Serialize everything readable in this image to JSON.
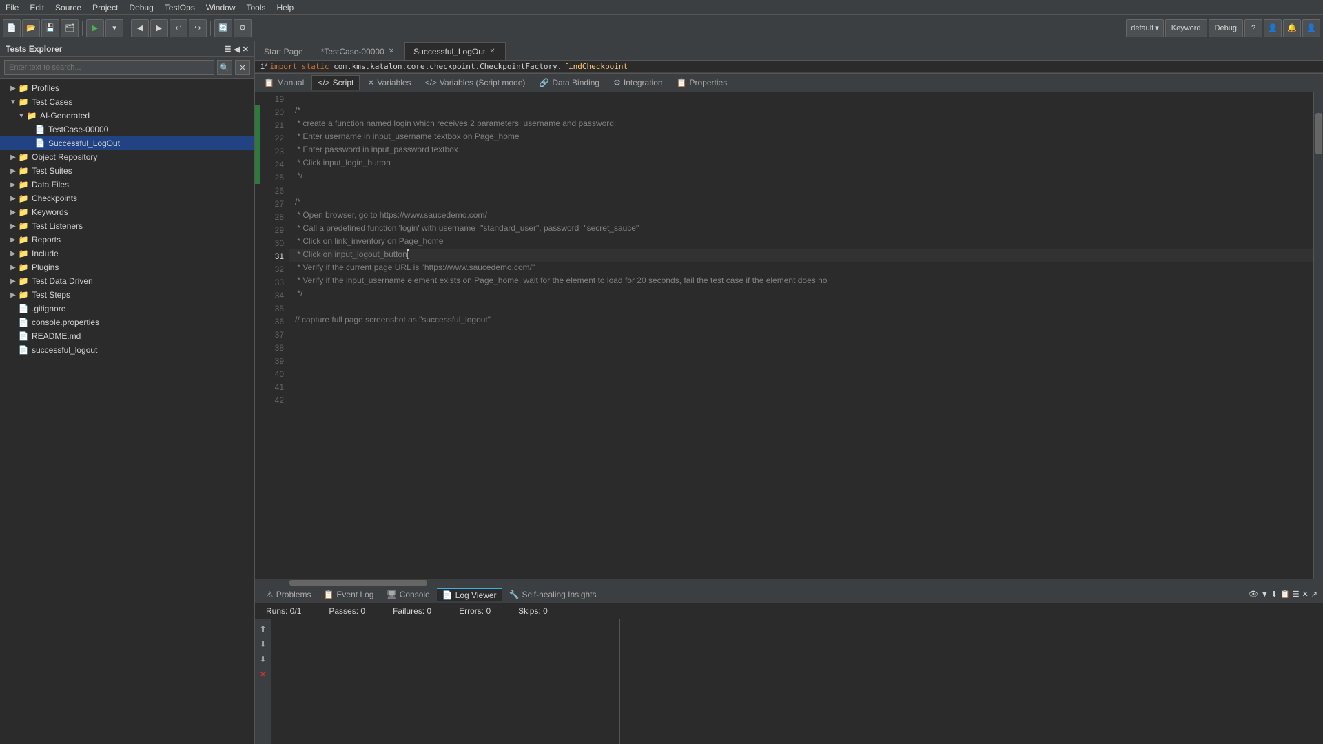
{
  "menubar": {
    "items": [
      "File",
      "Edit",
      "Source",
      "Project",
      "Debug",
      "TestOps",
      "Window",
      "Tools",
      "Help"
    ]
  },
  "toolbar": {
    "dropdown_profile": "default",
    "btn_keyword": "Keyword",
    "btn_debug": "Debug"
  },
  "sidebar": {
    "title": "Tests Explorer",
    "search_placeholder": "Enter text to search...",
    "tree": [
      {
        "id": "profiles",
        "label": "Profiles",
        "indent": 1,
        "arrow": "▶",
        "icon": "📁",
        "type": "folder"
      },
      {
        "id": "test-cases",
        "label": "Test Cases",
        "indent": 1,
        "arrow": "▼",
        "icon": "📁",
        "type": "folder",
        "expanded": true
      },
      {
        "id": "ai-generated",
        "label": "AI-Generated",
        "indent": 2,
        "arrow": "▼",
        "icon": "📁",
        "type": "folder"
      },
      {
        "id": "testcase-00000",
        "label": "TestCase-00000",
        "indent": 3,
        "arrow": "",
        "icon": "📄",
        "type": "file"
      },
      {
        "id": "successful-logout",
        "label": "Successful_LogOut",
        "indent": 3,
        "arrow": "",
        "icon": "📄",
        "type": "file",
        "selected": true
      },
      {
        "id": "object-repository",
        "label": "Object Repository",
        "indent": 1,
        "arrow": "▶",
        "icon": "📁",
        "type": "folder"
      },
      {
        "id": "test-suites",
        "label": "Test Suites",
        "indent": 1,
        "arrow": "▶",
        "icon": "📁",
        "type": "folder"
      },
      {
        "id": "data-files",
        "label": "Data Files",
        "indent": 1,
        "arrow": "▶",
        "icon": "📁",
        "type": "folder"
      },
      {
        "id": "checkpoints",
        "label": "Checkpoints",
        "indent": 1,
        "arrow": "▶",
        "icon": "📁",
        "type": "folder"
      },
      {
        "id": "keywords",
        "label": "Keywords",
        "indent": 1,
        "arrow": "▶",
        "icon": "📁",
        "type": "folder"
      },
      {
        "id": "test-listeners",
        "label": "Test Listeners",
        "indent": 1,
        "arrow": "▶",
        "icon": "📁",
        "type": "folder"
      },
      {
        "id": "reports",
        "label": "Reports",
        "indent": 1,
        "arrow": "▶",
        "icon": "📁",
        "type": "folder"
      },
      {
        "id": "include",
        "label": "Include",
        "indent": 1,
        "arrow": "▶",
        "icon": "📁",
        "type": "folder"
      },
      {
        "id": "plugins",
        "label": "Plugins",
        "indent": 1,
        "arrow": "▶",
        "icon": "📁",
        "type": "folder"
      },
      {
        "id": "test-data-driven",
        "label": "Test Data Driven",
        "indent": 1,
        "arrow": "▶",
        "icon": "📁",
        "type": "folder"
      },
      {
        "id": "test-steps",
        "label": "Test Steps",
        "indent": 1,
        "arrow": "▶",
        "icon": "📁",
        "type": "folder"
      },
      {
        "id": "gitignore",
        "label": ".gitignore",
        "indent": 1,
        "arrow": "",
        "icon": "📄",
        "type": "file"
      },
      {
        "id": "console-properties",
        "label": "console.properties",
        "indent": 1,
        "arrow": "",
        "icon": "📄",
        "type": "file"
      },
      {
        "id": "readme",
        "label": "README.md",
        "indent": 1,
        "arrow": "",
        "icon": "📄",
        "type": "file"
      },
      {
        "id": "successful-logout-file",
        "label": "successful_logout",
        "indent": 1,
        "arrow": "",
        "icon": "📄",
        "type": "file"
      }
    ]
  },
  "tabs": [
    {
      "id": "start-page",
      "label": "Start Page",
      "closable": false,
      "active": false
    },
    {
      "id": "testcase-00000-tab",
      "label": "*TestCase-00000",
      "closable": true,
      "active": false
    },
    {
      "id": "successful-logout-tab",
      "label": "Successful_LogOut",
      "closable": true,
      "active": true
    }
  ],
  "breadcrumb": "1* import static com.kms.katalon.core.checkpoint.CheckpointFactory.findCheckpoint",
  "code": {
    "lines": [
      {
        "num": "19",
        "content": "",
        "changed": false
      },
      {
        "num": "20",
        "content": "/* ",
        "changed": true,
        "parts": [
          {
            "t": "comment",
            "v": "/* "
          }
        ]
      },
      {
        "num": "21",
        "content": " * create a function named login which receives 2 parameters: username and password:",
        "changed": true
      },
      {
        "num": "22",
        "content": " * Enter username in input_username textbox on Page_home",
        "changed": true
      },
      {
        "num": "23",
        "content": " * Enter password in input_password textbox",
        "changed": true
      },
      {
        "num": "24",
        "content": " * Click input_login_button",
        "changed": true
      },
      {
        "num": "25",
        "content": " */ ",
        "changed": true
      },
      {
        "num": "26",
        "content": "",
        "changed": false
      },
      {
        "num": "27",
        "content": "/* ",
        "changed": false
      },
      {
        "num": "28",
        "content": " * Open browser, go to https://www.saucedemo.com/",
        "changed": false
      },
      {
        "num": "29",
        "content": " * Call a predefined function 'login' with username=\"standard_user\", password=\"secret_sauce\"",
        "changed": false
      },
      {
        "num": "30",
        "content": " * Click on link_inventory on Page_home",
        "changed": false
      },
      {
        "num": "31",
        "content": " * Click on input_logout_button",
        "changed": false
      },
      {
        "num": "32",
        "content": " * Verify if the current page URL is \"https://www.saucedemo.com/\"",
        "changed": false
      },
      {
        "num": "33",
        "content": " * Verify if the input_username element exists on Page_home, wait for the element to load for 20 seconds, fail the test case if the element does no",
        "changed": false
      },
      {
        "num": "34",
        "content": " */",
        "changed": false
      },
      {
        "num": "35",
        "content": "",
        "changed": false
      },
      {
        "num": "36",
        "content": "// capture full page screenshot as \"successful_logout\"",
        "changed": false
      },
      {
        "num": "37",
        "content": "",
        "changed": false
      },
      {
        "num": "38",
        "content": "",
        "changed": false
      },
      {
        "num": "39",
        "content": "",
        "changed": false
      },
      {
        "num": "40",
        "content": "",
        "changed": false
      },
      {
        "num": "41",
        "content": "",
        "changed": false
      },
      {
        "num": "42",
        "content": "",
        "changed": false
      }
    ]
  },
  "script_tabs": [
    {
      "id": "manual",
      "label": "Manual",
      "active": false
    },
    {
      "id": "script",
      "label": "Script",
      "active": true
    },
    {
      "id": "variables",
      "label": "Variables",
      "active": false
    },
    {
      "id": "variables-script",
      "label": "Variables (Script mode)",
      "active": false
    },
    {
      "id": "data-binding",
      "label": "Data Binding",
      "active": false
    },
    {
      "id": "integration",
      "label": "Integration",
      "active": false
    },
    {
      "id": "properties",
      "label": "Properties",
      "active": false
    }
  ],
  "bottom_tabs": [
    {
      "id": "problems",
      "label": "Problems",
      "icon": "⚠",
      "active": false
    },
    {
      "id": "event-log",
      "label": "Event Log",
      "icon": "📋",
      "active": false
    },
    {
      "id": "console",
      "label": "Console",
      "icon": "🖥",
      "active": false
    },
    {
      "id": "log-viewer",
      "label": "Log Viewer",
      "icon": "📄",
      "active": true
    },
    {
      "id": "self-healing",
      "label": "Self-healing Insights",
      "icon": "🔧",
      "active": false
    }
  ],
  "stats": {
    "runs": "Runs: 0/1",
    "passes": "Passes: 0",
    "failures": "Failures: 0",
    "errors": "Errors: 0",
    "skips": "Skips: 0"
  },
  "bottom_toolbar_right": [
    "👁",
    "▼",
    "⬇",
    "📋",
    "☰",
    "✕",
    "↗"
  ]
}
